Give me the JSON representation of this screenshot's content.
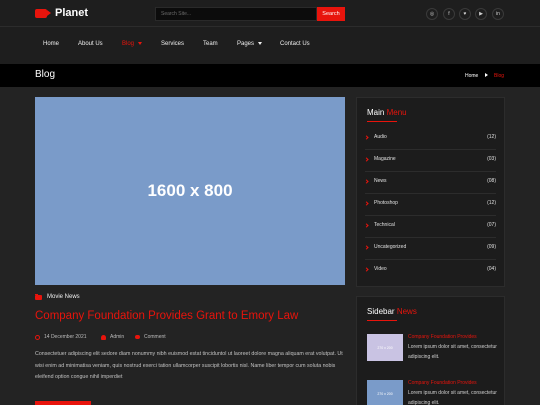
{
  "colors": {
    "accent": "#e8140c",
    "background": "#232323",
    "header": "#1e1e1e",
    "image_placeholder": "#7a9bc9"
  },
  "brand": {
    "name": "Planet",
    "icon": "video-camera-icon"
  },
  "search": {
    "placeholder": "Search Site...",
    "button_label": "Search"
  },
  "social": [
    {
      "icon": "instagram-icon",
      "glyph": "◎"
    },
    {
      "icon": "facebook-icon",
      "glyph": "f"
    },
    {
      "icon": "twitter-icon",
      "glyph": "♥"
    },
    {
      "icon": "youtube-icon",
      "glyph": "▶"
    },
    {
      "icon": "linkedin-icon",
      "glyph": "in"
    }
  ],
  "nav": {
    "items": [
      {
        "label": "Home"
      },
      {
        "label": "About Us"
      },
      {
        "label": "Blog",
        "active": true,
        "dropdown": true
      },
      {
        "label": "Services"
      },
      {
        "label": "Team"
      },
      {
        "label": "Pages",
        "dropdown": true
      },
      {
        "label": "Contact Us"
      }
    ]
  },
  "page_header": {
    "title": "Blog",
    "breadcrumb": [
      "Home",
      "Blog"
    ]
  },
  "post": {
    "image_label": "1600 x 800",
    "category": "Movie News",
    "title": "Company Foundation Provides Grant to Emory Law",
    "date": "14 December 2021",
    "author": "Admin",
    "comments": "Comment",
    "excerpt": "Consectetuer adipiscing elit sedore diam nonummy nibh euismod estat tinciduntol ut laoreet dolore magna aliquam erat volutpat. Ut wisi enim ad minimatisa veniam, quis nostrud exerci tation ullamcorper suscipit lobortis nisl. Name liber tempor cum soluta nobis eleifend option congue nihil imperdiet"
  },
  "sidebar": {
    "menu_widget": {
      "title_part1": "Main",
      "title_part2": "Menu",
      "items": [
        {
          "label": "Audio",
          "count": "(12)"
        },
        {
          "label": "Magazine",
          "count": "(03)"
        },
        {
          "label": "News",
          "count": "(08)"
        },
        {
          "label": "Photoshop",
          "count": "(12)"
        },
        {
          "label": "Technical",
          "count": "(07)"
        },
        {
          "label": "Uncategorized",
          "count": "(09)"
        },
        {
          "label": "Video",
          "count": "(04)"
        }
      ]
    },
    "news_widget": {
      "title_part1": "Sidebar",
      "title_part2": "News",
      "items": [
        {
          "thumb_label": "270 x 200",
          "thumb_color": "#c9c3e3",
          "title": "Company Foundation Provides",
          "text": "Lorem ipsum dolor sit amet, consectetur adipiscing elit."
        },
        {
          "thumb_label": "270 x 200",
          "thumb_color": "#7a9bc9",
          "title": "Company Foundation Provides",
          "text": "Lorem ipsum dolor sit amet, consectetur adipiscing elit."
        }
      ]
    }
  }
}
